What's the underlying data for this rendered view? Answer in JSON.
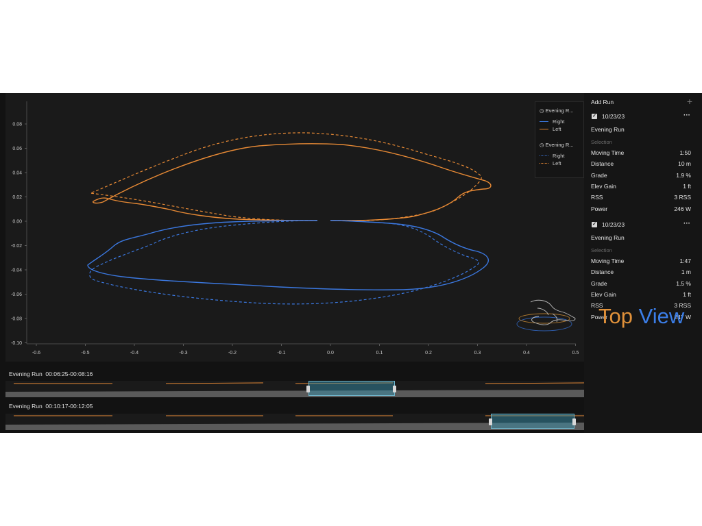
{
  "plot": {
    "y_ticks": [
      "0.08",
      "0.06",
      "0.04",
      "0.02",
      "0.00",
      "-0.02",
      "-0.04",
      "-0.06",
      "-0.08",
      "-0.10"
    ],
    "x_ticks": [
      "-0.6",
      "-0.5",
      "-0.4",
      "-0.3",
      "-0.2",
      "-0.1",
      "0.0",
      "0.1",
      "0.2",
      "0.3",
      "0.4",
      "0.5"
    ],
    "colors": {
      "right": "#3b78e0",
      "left": "#e88a35"
    }
  },
  "legend": {
    "run1": {
      "title": "Evening R...",
      "right": "Right",
      "left": "Left"
    },
    "run2": {
      "title": "Evening R...",
      "right": "Right",
      "left": "Left"
    }
  },
  "sidebar": {
    "add_run": "Add Run",
    "add_icon": "plus-icon",
    "runs": [
      {
        "date": "10/23/23",
        "name": "Evening Run",
        "selection": "Selection",
        "stats": [
          {
            "label": "Moving Time",
            "value": "1:50"
          },
          {
            "label": "Distance",
            "value": "10 m"
          },
          {
            "label": "Grade",
            "value": "1.9 %"
          },
          {
            "label": "Elev Gain",
            "value": "1 ft"
          },
          {
            "label": "RSS",
            "value": "3 RSS"
          },
          {
            "label": "Power",
            "value": "246 W"
          }
        ]
      },
      {
        "date": "10/23/23",
        "name": "Evening Run",
        "selection": "Selection",
        "stats": [
          {
            "label": "Moving Time",
            "value": "1:47"
          },
          {
            "label": "Distance",
            "value": "1 m"
          },
          {
            "label": "Grade",
            "value": "1.5 %"
          },
          {
            "label": "Elev Gain",
            "value": "1 ft"
          },
          {
            "label": "RSS",
            "value": "3 RSS"
          },
          {
            "label": "Power",
            "value": "247 W"
          }
        ]
      }
    ]
  },
  "strips": [
    {
      "title": "Evening Run  00:06:25-00:08:16"
    },
    {
      "title": "Evening Run  00:10:17-00:12:05"
    }
  ],
  "brand": {
    "word1": "Top",
    "word2": "View",
    "color1": "#e0913a",
    "color2": "#3b7ee8"
  }
}
